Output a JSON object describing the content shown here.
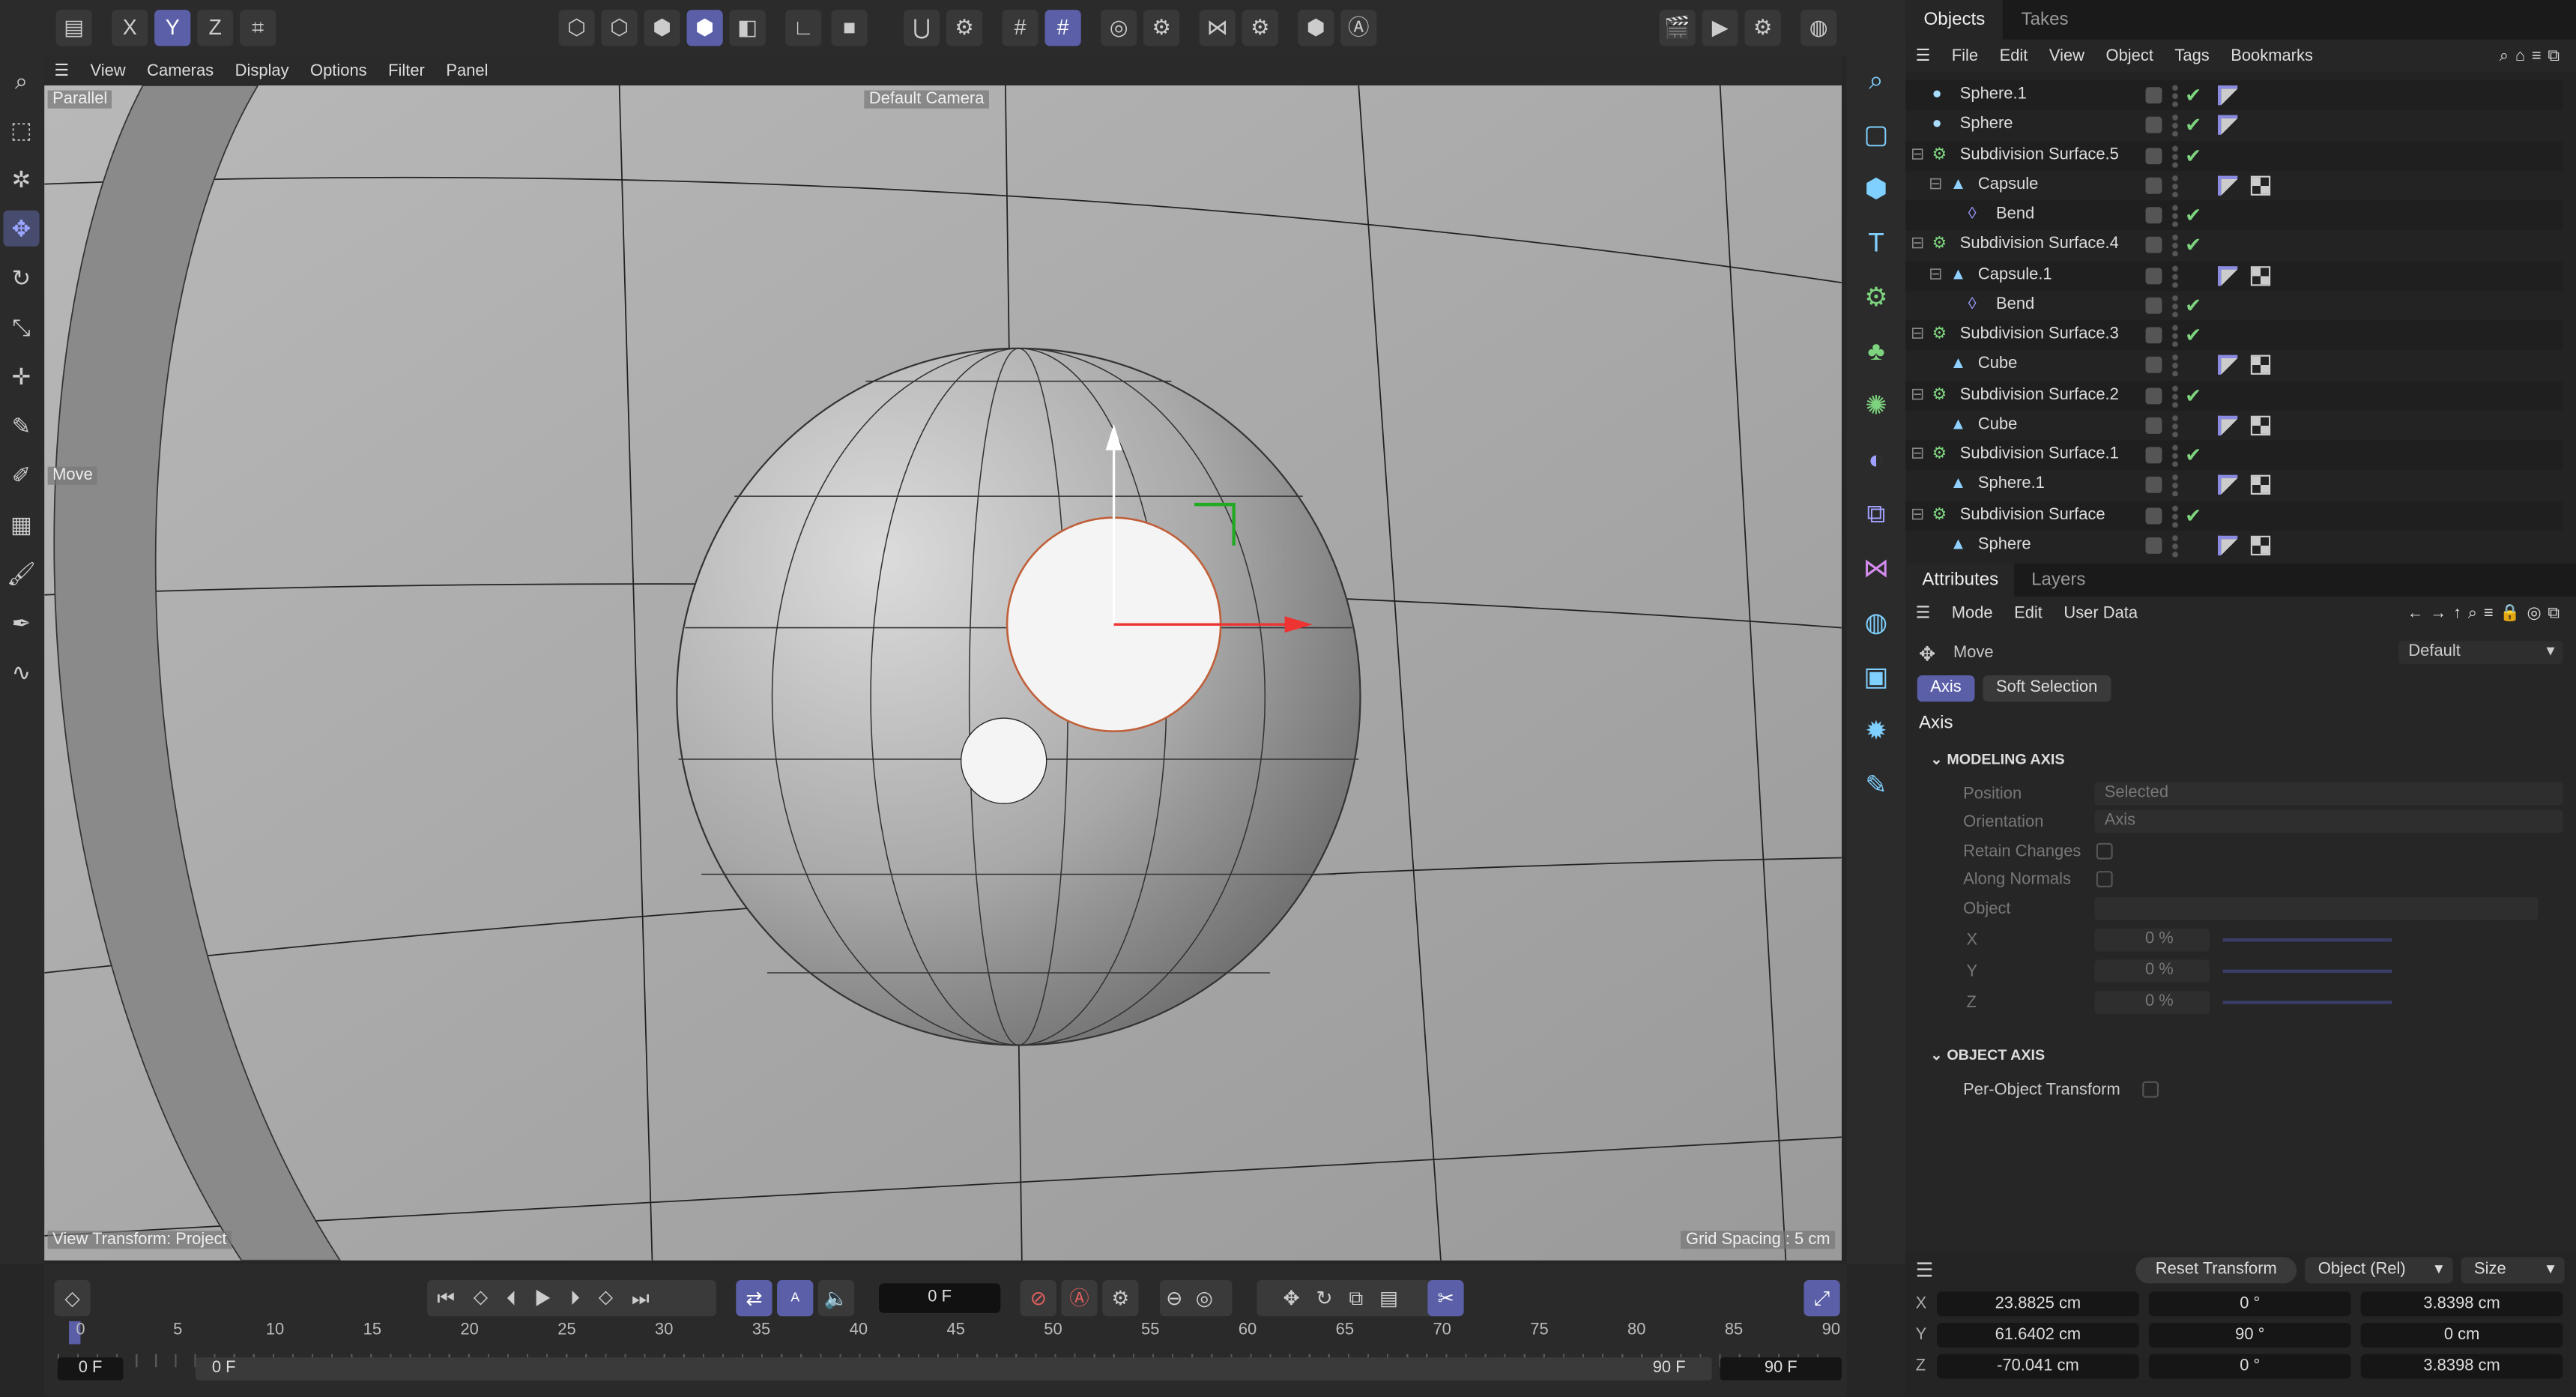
{
  "toolbar": {
    "axis_x": "X",
    "axis_y": "Y",
    "axis_z": "Z"
  },
  "viewport_menu": [
    "View",
    "Cameras",
    "Display",
    "Options",
    "Filter",
    "Panel"
  ],
  "viewport": {
    "projection": "Parallel",
    "camera": "Default Camera",
    "tool_hint": "Move",
    "status": "View Transform: Project",
    "grid_spacing": "Grid Spacing : 5 cm"
  },
  "objects_panel": {
    "tabs": [
      "Objects",
      "Takes"
    ],
    "menu": [
      "File",
      "Edit",
      "View",
      "Object",
      "Tags",
      "Bookmarks"
    ],
    "rows": [
      {
        "name": "Sphere.1",
        "indent": 0,
        "icon": "sphere-primitive-icon",
        "check": true,
        "tags": 1
      },
      {
        "name": "Sphere",
        "indent": 0,
        "icon": "sphere-primitive-icon",
        "check": true,
        "tags": 1
      },
      {
        "name": "Subdivision Surface.5",
        "indent": 0,
        "icon": "subdivision-icon",
        "check": true,
        "tags": 0
      },
      {
        "name": "Capsule",
        "indent": 1,
        "icon": "polygon-object-icon",
        "check": false,
        "tags": 2
      },
      {
        "name": "Bend",
        "indent": 2,
        "icon": "bend-deformer-icon",
        "check": true,
        "tags": 0
      },
      {
        "name": "Subdivision Surface.4",
        "indent": 0,
        "icon": "subdivision-icon",
        "check": true,
        "tags": 0
      },
      {
        "name": "Capsule.1",
        "indent": 1,
        "icon": "polygon-object-icon",
        "check": false,
        "tags": 2
      },
      {
        "name": "Bend",
        "indent": 2,
        "icon": "bend-deformer-icon",
        "check": true,
        "tags": 0
      },
      {
        "name": "Subdivision Surface.3",
        "indent": 0,
        "icon": "subdivision-icon",
        "check": true,
        "tags": 0
      },
      {
        "name": "Cube",
        "indent": 1,
        "icon": "polygon-object-icon",
        "check": false,
        "tags": 2
      },
      {
        "name": "Subdivision Surface.2",
        "indent": 0,
        "icon": "subdivision-icon",
        "check": true,
        "tags": 0
      },
      {
        "name": "Cube",
        "indent": 1,
        "icon": "polygon-object-icon",
        "check": false,
        "tags": 2
      },
      {
        "name": "Subdivision Surface.1",
        "indent": 0,
        "icon": "subdivision-icon",
        "check": true,
        "tags": 0
      },
      {
        "name": "Sphere.1",
        "indent": 1,
        "icon": "polygon-object-icon",
        "check": false,
        "tags": 2
      },
      {
        "name": "Subdivision Surface",
        "indent": 0,
        "icon": "subdivision-icon",
        "check": true,
        "tags": 0
      },
      {
        "name": "Sphere",
        "indent": 1,
        "icon": "polygon-object-icon",
        "check": false,
        "tags": 2
      }
    ]
  },
  "attributes": {
    "tabs": [
      "Attributes",
      "Layers"
    ],
    "menu": [
      "Mode",
      "Edit",
      "User Data"
    ],
    "tool": "Move",
    "preset": "Default",
    "subtabs": [
      "Axis",
      "Soft Selection"
    ],
    "section_title": "Axis",
    "modeling_axis": "MODELING AXIS",
    "position_label": "Position",
    "position_value": "Selected",
    "orientation_label": "Orientation",
    "orientation_value": "Axis",
    "retain_changes": "Retain Changes",
    "along_normals": "Along Normals",
    "object_label": "Object",
    "x_label": "X",
    "y_label": "Y",
    "z_label": "Z",
    "x_value": "0 %",
    "y_value": "0 %",
    "z_value": "0 %",
    "object_axis": "OBJECT AXIS",
    "per_object": "Per-Object Transform"
  },
  "coordinates": {
    "reset": "Reset Transform",
    "mode": "Object (Rel)",
    "size_mode": "Size",
    "rows": [
      {
        "axis": "X",
        "pos": "23.8825 cm",
        "rot": "0 °",
        "size": "3.8398 cm"
      },
      {
        "axis": "Y",
        "pos": "61.6402 cm",
        "rot": "90 °",
        "size": "0 cm"
      },
      {
        "axis": "Z",
        "pos": "-70.041 cm",
        "rot": "0 °",
        "size": "3.8398 cm"
      }
    ]
  },
  "timeline": {
    "current_frame": "0 F",
    "ticks": [
      "0",
      "5",
      "10",
      "15",
      "20",
      "25",
      "30",
      "35",
      "40",
      "45",
      "50",
      "55",
      "60",
      "65",
      "70",
      "75",
      "80",
      "85",
      "90"
    ],
    "start": "0 F",
    "range_start": "0 F",
    "range_end": "90 F",
    "end": "90 F"
  },
  "colors": {
    "accent": "#5a5fa8",
    "check": "#7ed37f",
    "record": "#e35f5f"
  }
}
